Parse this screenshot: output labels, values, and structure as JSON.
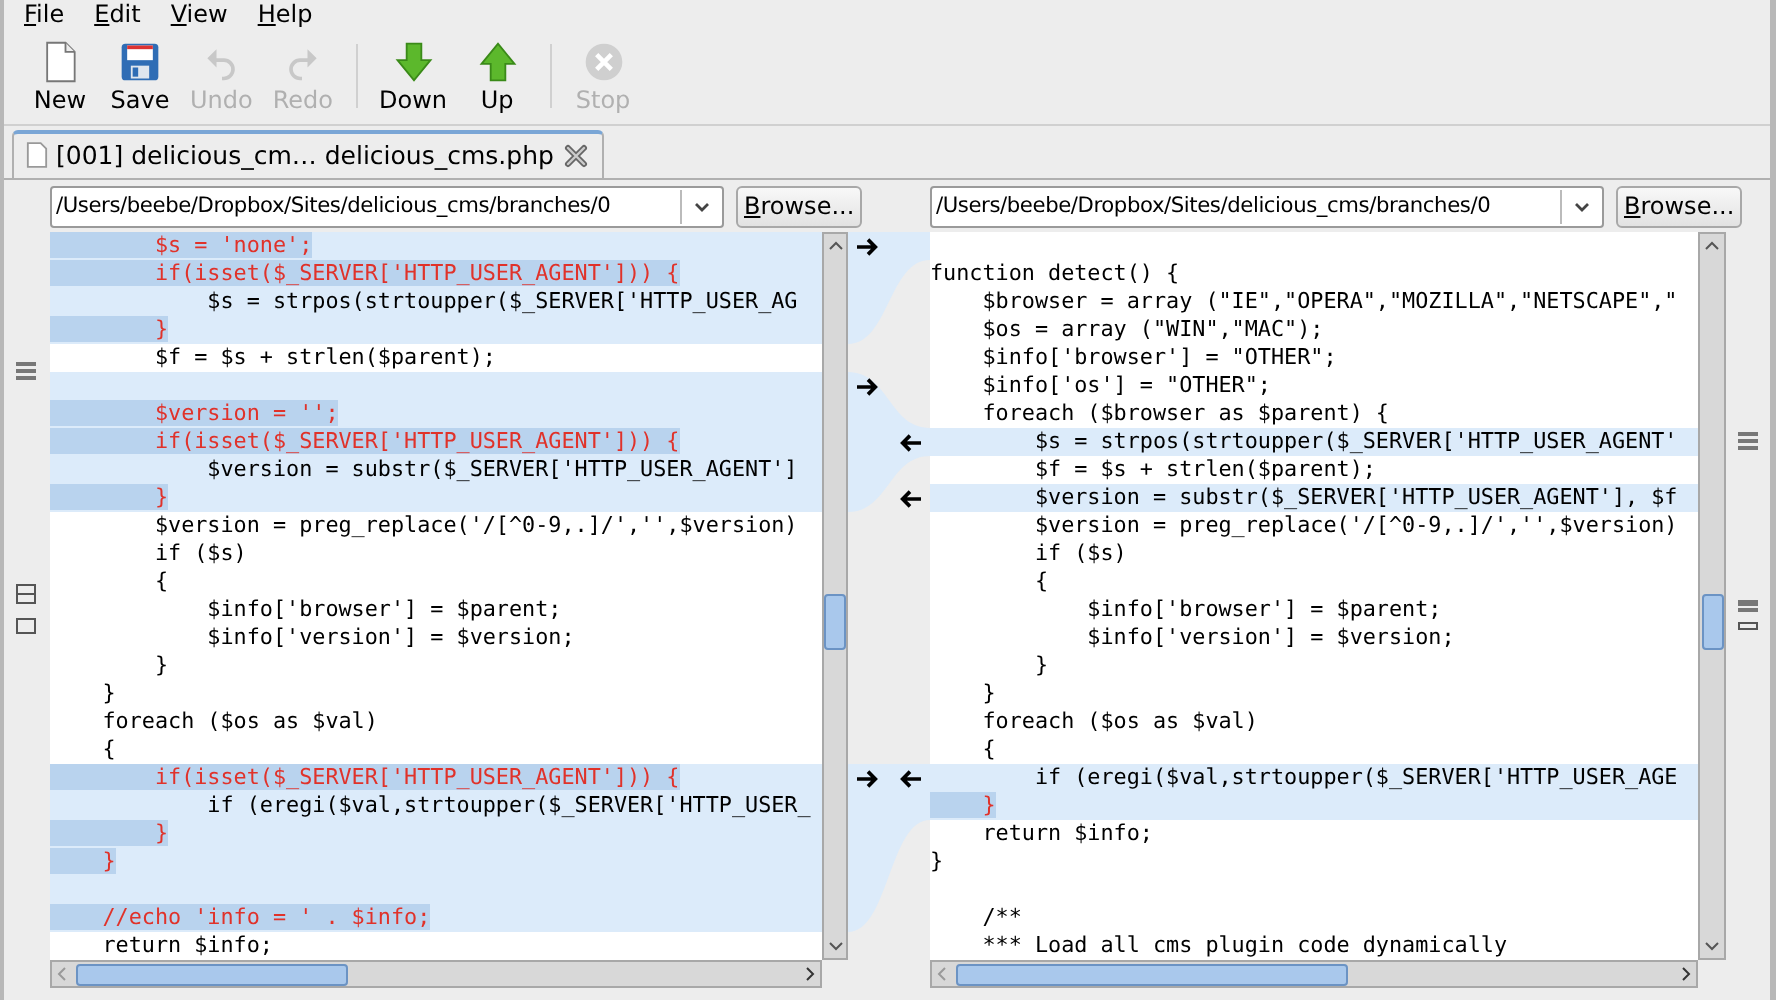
{
  "menu": [
    {
      "label": "File"
    },
    {
      "label": "Edit"
    },
    {
      "label": "View"
    },
    {
      "label": "Help"
    }
  ],
  "toolbar": [
    [
      {
        "label": "New",
        "kind": "new",
        "disabled": false
      },
      {
        "label": "Save",
        "kind": "save",
        "disabled": false
      },
      {
        "label": "Undo",
        "kind": "undo",
        "disabled": true
      },
      {
        "label": "Redo",
        "kind": "redo",
        "disabled": true
      }
    ],
    [
      {
        "label": "Down",
        "kind": "down",
        "disabled": false
      },
      {
        "label": "Up",
        "kind": "up",
        "disabled": false
      }
    ],
    [
      {
        "label": "Stop",
        "kind": "stop",
        "disabled": true
      }
    ]
  ],
  "tabs": [
    {
      "label": "[001] delicious_cm… delicious_cms.php",
      "selected": true
    }
  ],
  "panes": [
    {
      "path": "/Users/beebe/Dropbox/Sites/delicious_cms/branches/0",
      "browse": "Browse...",
      "lines": [
        {
          "text": "        $s = 'none';",
          "kind": "removed",
          "arrow": true
        },
        {
          "text": "        if(isset($_SERVER['HTTP_USER_AGENT'])) {",
          "kind": "removed",
          "arrow": false
        },
        {
          "text": "            $s = strpos(strtoupper($_SERVER['HTTP_USER_AG",
          "kind": "changed",
          "arrow": false
        },
        {
          "text": "        }",
          "kind": "removed",
          "arrow": false
        },
        {
          "text": "        $f = $s + strlen($parent);",
          "kind": "plain",
          "arrow": false
        },
        {
          "kind": "changed",
          "arrow": true
        },
        {
          "text": "        $version = '';",
          "kind": "removed",
          "arrow": false
        },
        {
          "text": "        if(isset($_SERVER['HTTP_USER_AGENT'])) {",
          "kind": "removed",
          "arrow": false
        },
        {
          "text": "            $version = substr($_SERVER['HTTP_USER_AGENT']",
          "kind": "changed",
          "arrow": false
        },
        {
          "text": "        }",
          "kind": "removed",
          "arrow": false
        },
        {
          "text": "        $version = preg_replace('/[^0-9,.]/','',$version)",
          "kind": "plain",
          "arrow": false
        },
        {
          "text": "        if ($s)",
          "kind": "plain",
          "arrow": false
        },
        {
          "text": "        {",
          "kind": "plain",
          "arrow": false
        },
        {
          "text": "            $info['browser'] = $parent;",
          "kind": "plain",
          "arrow": false
        },
        {
          "text": "            $info['version'] = $version;",
          "kind": "plain",
          "arrow": false
        },
        {
          "text": "        }",
          "kind": "plain",
          "arrow": false
        },
        {
          "text": "    }",
          "kind": "plain",
          "arrow": false
        },
        {
          "text": "    foreach ($os as $val)",
          "kind": "plain",
          "arrow": false
        },
        {
          "text": "    {",
          "kind": "plain",
          "arrow": false
        },
        {
          "text": "        if(isset($_SERVER['HTTP_USER_AGENT'])) {",
          "kind": "removed",
          "arrow": true
        },
        {
          "text": "            if (eregi($val,strtoupper($_SERVER['HTTP_USER_",
          "kind": "changed",
          "arrow": false
        },
        {
          "text": "        }",
          "kind": "removed",
          "arrow": false
        },
        {
          "text": "    }",
          "kind": "removed",
          "arrow": false
        },
        {
          "kind": "changed",
          "arrow": false
        },
        {
          "text": "    //echo 'info = ' . $info;",
          "kind": "removed",
          "arrow": false
        },
        {
          "text": "    return $info;",
          "kind": "plain",
          "arrow": false
        }
      ]
    },
    {
      "path": "/Users/beebe/Dropbox/Sites/delicious_cms/branches/0",
      "browse": "Browse...",
      "lines": [
        {
          "kind": "plain",
          "arrow": false
        },
        {
          "text": "function detect() {",
          "kind": "plain",
          "arrow": false
        },
        {
          "text": "    $browser = array (\"IE\",\"OPERA\",\"MOZILLA\",\"NETSCAPE\",\"",
          "kind": "plain",
          "arrow": false
        },
        {
          "text": "    $os = array (\"WIN\",\"MAC\");",
          "kind": "plain",
          "arrow": false
        },
        {
          "text": "    $info['browser'] = \"OTHER\";",
          "kind": "plain",
          "arrow": false
        },
        {
          "text": "    $info['os'] = \"OTHER\";",
          "kind": "plain",
          "arrow": false
        },
        {
          "text": "    foreach ($browser as $parent) {",
          "kind": "plain",
          "arrow": false
        },
        {
          "text": "        $s = strpos(strtoupper($_SERVER['HTTP_USER_AGENT'",
          "kind": "changed",
          "arrow": true
        },
        {
          "text": "        $f = $s + strlen($parent);",
          "kind": "plain",
          "arrow": false
        },
        {
          "text": "        $version = substr($_SERVER['HTTP_USER_AGENT'], $f",
          "kind": "changed",
          "arrow": true
        },
        {
          "text": "        $version = preg_replace('/[^0-9,.]/','',$version)",
          "kind": "plain",
          "arrow": false
        },
        {
          "text": "        if ($s)",
          "kind": "plain",
          "arrow": false
        },
        {
          "text": "        {",
          "kind": "plain",
          "arrow": false
        },
        {
          "text": "            $info['browser'] = $parent;",
          "kind": "plain",
          "arrow": false
        },
        {
          "text": "            $info['version'] = $version;",
          "kind": "plain",
          "arrow": false
        },
        {
          "text": "        }",
          "kind": "plain",
          "arrow": false
        },
        {
          "text": "    }",
          "kind": "plain",
          "arrow": false
        },
        {
          "text": "    foreach ($os as $val)",
          "kind": "plain",
          "arrow": false
        },
        {
          "text": "    {",
          "kind": "plain",
          "arrow": false
        },
        {
          "text": "        if (eregi($val,strtoupper($_SERVER['HTTP_USER_AGE",
          "kind": "changed",
          "arrow": true
        },
        {
          "text": "    }",
          "kind": "removed",
          "arrow": false
        },
        {
          "text": "    return $info;",
          "kind": "plain",
          "arrow": false
        },
        {
          "text": "}",
          "kind": "plain",
          "arrow": false
        },
        {
          "kind": "plain",
          "arrow": false
        },
        {
          "text": "    /**",
          "kind": "plain",
          "arrow": false
        },
        {
          "text": "    *** Load all cms plugin code dynamically",
          "kind": "plain",
          "arrow": false
        }
      ]
    }
  ]
}
